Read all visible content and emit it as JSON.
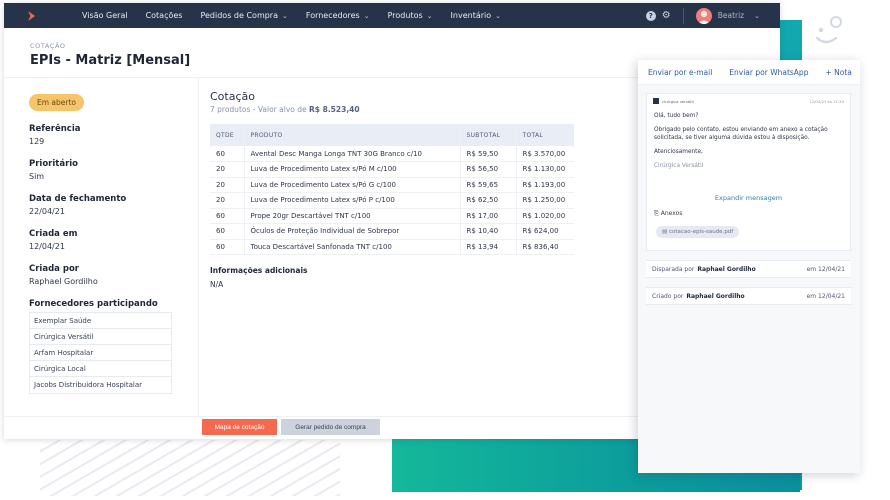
{
  "nav": {
    "items": [
      {
        "label": "Visão Geral",
        "has_menu": false
      },
      {
        "label": "Cotações",
        "has_menu": false
      },
      {
        "label": "Pedidos de Compra",
        "has_menu": true
      },
      {
        "label": "Fornecedores",
        "has_menu": true
      },
      {
        "label": "Produtos",
        "has_menu": true
      },
      {
        "label": "Inventário",
        "has_menu": true
      }
    ],
    "help_icon": "question-icon",
    "settings_icon": "gear-icon",
    "user_name": "Beatriz"
  },
  "page": {
    "eyebrow": "COTAÇÃO",
    "title": "EPIs - Matriz [Mensal]"
  },
  "details": {
    "status": "Em aberto",
    "fields": [
      {
        "label": "Referência",
        "value": "129"
      },
      {
        "label": "Prioritário",
        "value": "Sim"
      },
      {
        "label": "Data de fechamento",
        "value": "22/04/21"
      },
      {
        "label": "Criada em",
        "value": "12/04/21"
      },
      {
        "label": "Criada por",
        "value": "Raphael Gordilho"
      }
    ],
    "suppliers_label": "Fornecedores participando",
    "suppliers": [
      "Exemplar Saúde",
      "Cirúrgica Versátil",
      "Arfam Hospitalar",
      "Cirúrgica Local",
      "Jacobs Distribuidora Hospitalar"
    ]
  },
  "quote": {
    "title": "Cotação",
    "subtitle_prefix": "7 produtos - Valor alvo de",
    "target_value": "R$ 8.523,40",
    "columns": [
      "QTDE",
      "PRODUTO",
      "SUBTOTAL",
      "TOTAL"
    ],
    "rows": [
      {
        "qty": "60",
        "product": "Avental Desc Manga Longa TNT 30G Branco c/10",
        "subtotal": "R$ 59,50",
        "total": "R$ 3.570,00"
      },
      {
        "qty": "20",
        "product": "Luva de Procedimento Latex s/Pó M c/100",
        "subtotal": "R$ 56,50",
        "total": "R$ 1.130,00"
      },
      {
        "qty": "20",
        "product": "Luva de Procedimento Latex s/Pó G c/100",
        "subtotal": "R$ 59,65",
        "total": "R$ 1.193,00"
      },
      {
        "qty": "20",
        "product": "Luva de Procedimento Latex s/Pó P c/100",
        "subtotal": "R$ 62,50",
        "total": "R$ 1.250,00"
      },
      {
        "qty": "60",
        "product": "Prope 20gr Descartável TNT c/100",
        "subtotal": "R$ 17,00",
        "total": "R$ 1.020,00"
      },
      {
        "qty": "60",
        "product": "Óculos de Proteção Individual de Sobrepor",
        "subtotal": "R$ 10,40",
        "total": "R$ 624,00"
      },
      {
        "qty": "60",
        "product": "Touca Descartável Sanfonada TNT c/100",
        "subtotal": "R$ 13,94",
        "total": "R$ 836,40"
      }
    ],
    "info_label": "Informações adicionais",
    "info_value": "N/A"
  },
  "actions": {
    "primary": "Mapa de cotação",
    "secondary": "Gerar pedido de compra"
  },
  "panel": {
    "links": [
      "Enviar por e-mail",
      "Enviar por WhatsApp",
      "+ Nota"
    ],
    "email": {
      "from": "cirúrgica versátil",
      "date": "12/04/21 às 11:34",
      "greeting": "Olá, tudo bem?",
      "body": "Obrigado pelo contato, estou enviando em anexo a cotação solicitada, se tiver alguma dúvida estou à disposição.",
      "closing": "Atenciosamente,",
      "signature": "Cirúrgica Versátil",
      "expand_label": "Expandir mensagem",
      "attachments_label": "Anexos",
      "attachment": "cotacao-epis-saude.pdf"
    },
    "log": [
      {
        "text": "Disparada por",
        "who": "Raphael Gordilho",
        "date": "em 12/04/21"
      },
      {
        "text": "Criado por",
        "who": "Raphael Gordilho",
        "date": "em 12/04/21"
      }
    ]
  },
  "colors": {
    "nav_bg": "#273349",
    "accent_orange": "#f46a4f",
    "status_badge": "#f5c46b",
    "link_blue": "#2f5aa8",
    "teal": "#14b89a"
  }
}
